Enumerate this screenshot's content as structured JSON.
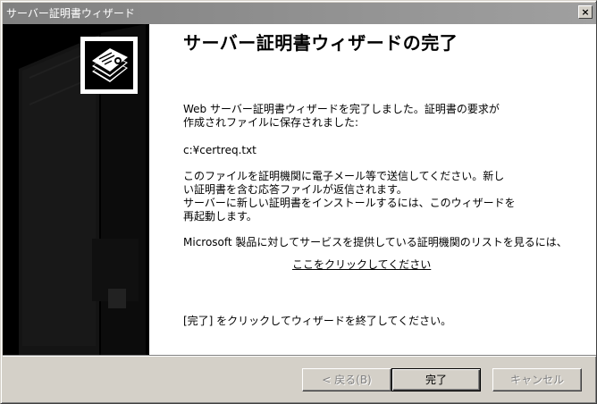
{
  "window": {
    "title": "サーバー証明書ウィザード",
    "close_label": "×"
  },
  "content": {
    "heading": "サーバー証明書ウィザードの完了",
    "paragraph1_line1": "Web サーバー証明書ウィザードを完了しました。証明書の要求が",
    "paragraph1_line2": "作成されファイルに保存されました:",
    "file_path": "c:¥certreq.txt",
    "paragraph2_line1": "このファイルを証明機関に電子メール等で送信してください。新し",
    "paragraph2_line2": "い証明書を含む応答ファイルが返信されます。",
    "paragraph2_line3": "サーバーに新しい証明書をインストールするには、このウィザードを",
    "paragraph2_line4": "再起動します。",
    "paragraph3": "Microsoft 製品に対してサービスを提供している証明機関のリストを見るには、",
    "link": "ここをクリックしてください",
    "finish_instruction": "[完了] をクリックしてウィザードを終了してください。"
  },
  "buttons": {
    "back": "< 戻る(B)",
    "finish": "完了",
    "cancel": "キャンセル"
  },
  "icons": {
    "wizard_logo": "certificate-stack-icon",
    "close": "close-icon"
  }
}
